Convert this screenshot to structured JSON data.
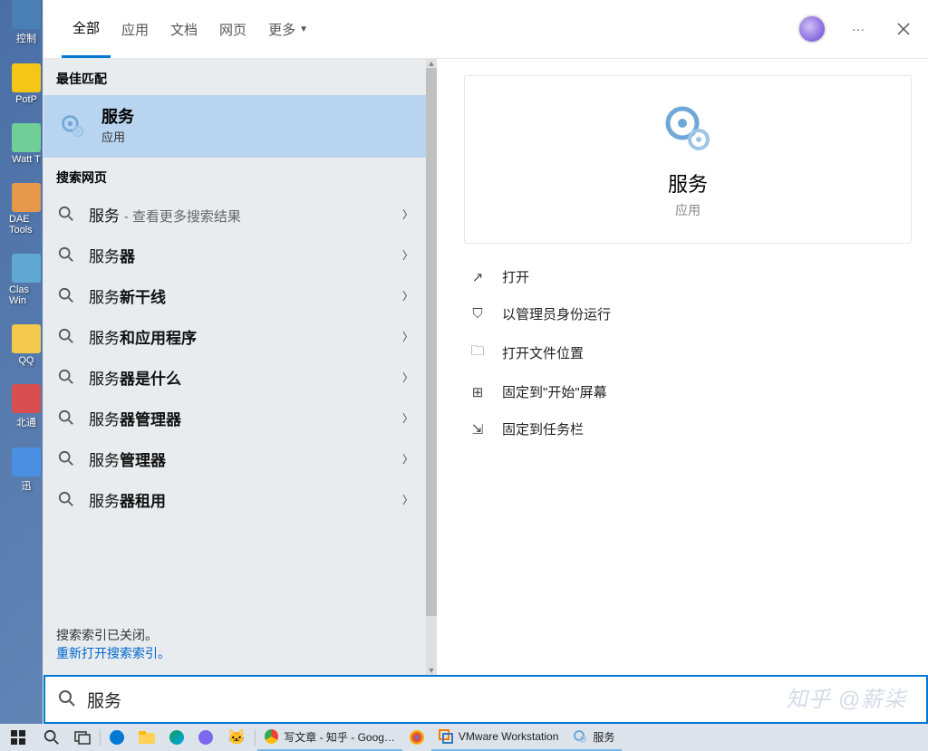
{
  "desktop_icons": [
    {
      "label": "控制",
      "color": "#4a7fb5"
    },
    {
      "label": "PotP",
      "color": "#f5c518"
    },
    {
      "label": "Watt T",
      "color": "#6fcf97"
    },
    {
      "label": "DAE Tools",
      "color": "#e6994a"
    },
    {
      "label": "Clas Win",
      "color": "#5fa8d3"
    },
    {
      "label": "QQ",
      "color": "#f2c94c"
    },
    {
      "label": "北通",
      "color": "#d94e4e"
    },
    {
      "label": "迅",
      "color": "#4a90e2"
    }
  ],
  "tabs": {
    "all": "全部",
    "apps": "应用",
    "docs": "文档",
    "web": "网页",
    "more": "更多"
  },
  "section": {
    "best_match": "最佳匹配",
    "web": "搜索网页"
  },
  "best": {
    "title": "服务",
    "sub": "应用"
  },
  "results": [
    {
      "prefix": "服务 ",
      "bold": "",
      "dim": "- 查看更多搜索结果"
    },
    {
      "prefix": "服务",
      "bold": "器",
      "dim": ""
    },
    {
      "prefix": "服务",
      "bold": "新干线",
      "dim": ""
    },
    {
      "prefix": "服务",
      "bold": "和应用程序",
      "dim": ""
    },
    {
      "prefix": "服务",
      "bold": "器是什么",
      "dim": ""
    },
    {
      "prefix": "服务",
      "bold": "器管理器",
      "dim": ""
    },
    {
      "prefix": "服务",
      "bold": "管理器",
      "dim": ""
    },
    {
      "prefix": "服务",
      "bold": "器租用",
      "dim": ""
    }
  ],
  "footer": {
    "status": "搜索索引已关闭。",
    "link": "重新打开搜索索引。"
  },
  "detail": {
    "title": "服务",
    "sub": "应用",
    "actions": [
      {
        "icon": "↗",
        "label": "打开"
      },
      {
        "icon": "⛉",
        "label": "以管理员身份运行"
      },
      {
        "icon": "🗀",
        "label": "打开文件位置"
      },
      {
        "icon": "⊞",
        "label": "固定到\"开始\"屏幕"
      },
      {
        "icon": "⇲",
        "label": "固定到任务栏"
      }
    ]
  },
  "search_value": "服务",
  "watermark": "知乎 @薪柒",
  "taskbar": [
    {
      "type": "win"
    },
    {
      "type": "search"
    },
    {
      "type": "taskview"
    },
    {
      "type": "sep"
    },
    {
      "type": "icon",
      "color": "#0078d4",
      "shape": "folder-blue"
    },
    {
      "type": "icon",
      "color": "#ffb900",
      "shape": "explorer"
    },
    {
      "type": "icon",
      "color": "#00a4ef",
      "shape": "edge"
    },
    {
      "type": "icon",
      "color": "#7b68ee",
      "shape": "camera"
    },
    {
      "type": "icon",
      "color": "#333",
      "shape": "cat"
    },
    {
      "type": "sep"
    },
    {
      "type": "task",
      "icon": "#f25022",
      "label": "写文章 - 知乎 - Goog…",
      "shape": "chrome"
    },
    {
      "type": "icon",
      "color": "#4285f4",
      "shape": "dots"
    },
    {
      "type": "task",
      "icon": "#f57c00",
      "label": "VMware Workstation",
      "shape": "vmware"
    },
    {
      "type": "task",
      "icon": "#808080",
      "label": "服务",
      "shape": "gear"
    }
  ]
}
